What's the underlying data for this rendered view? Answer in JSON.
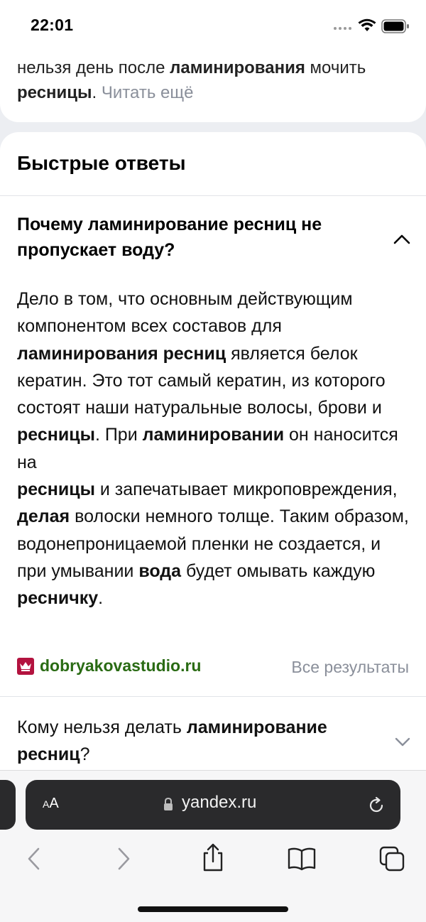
{
  "status": {
    "time": "22:01"
  },
  "previous_card": {
    "text_before": "нельзя день после ",
    "bold_1": "ламинирования",
    "text_mid": " мочить ",
    "bold_2": "ресницы",
    "text_after": ". ",
    "read_more": "Читать ещё"
  },
  "quick_answers": {
    "title": "Быстрые ответы",
    "q1": {
      "question": "Почему ламинирование ресниц не пропускает воду?",
      "answer": {
        "t1": "Дело в том, что основным действующим компонентом всех составов для ",
        "b1": "ламинирования ресниц",
        "t2": " является белок кератин. Это тот самый кератин, из которого состоят наши натуральные волосы, брови и ",
        "b2": "ресницы",
        "t3": ". При ",
        "b3": "ламинировании",
        "t4": " он наносится на ",
        "b4": "ресницы",
        "t5": " и запечатывает микроповреждения, ",
        "b5": "делая",
        "t6": " волоски немного толще. Таким образом, водонепроницаемой пленки не создается, и при умывании ",
        "b6": "вода",
        "t7": " будет омывать каждую ",
        "b7": "ресничку",
        "t8": "."
      },
      "source": "dobryakovastudio.ru",
      "all_results": "Все результаты"
    },
    "q2": {
      "t1": "Кому нельзя делать ",
      "b1": "ламинирование ресниц",
      "t2": "?"
    }
  },
  "browser": {
    "aa_small": "A",
    "aa_big": "A",
    "url": "yandex.ru"
  },
  "colors": {
    "source_green": "#2a6b14",
    "favicon_red": "#b3133f",
    "muted": "#8a8f9a"
  }
}
